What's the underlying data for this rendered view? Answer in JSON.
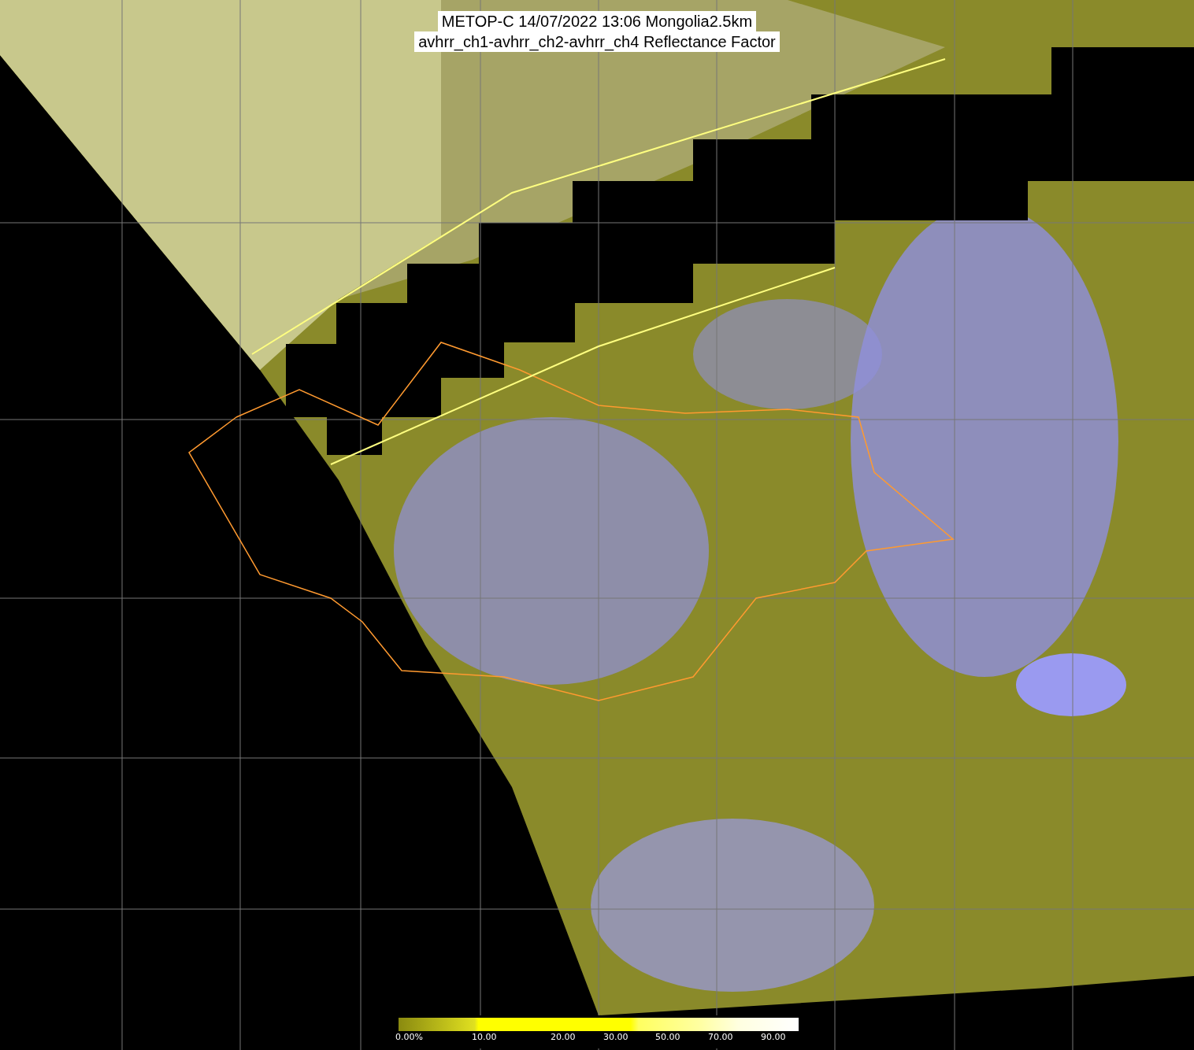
{
  "title_lines": [
    "METOP-C 14/07/2022 13:06 Mongolia2.5km",
    "avhrr_ch1-avhrr_ch2-avhrr_ch4 Reflectance Factor"
  ],
  "colorbar": {
    "tick_labels": [
      "0.00%",
      "10.00",
      "20.00",
      "30.00",
      "50.00",
      "70.00",
      "90.00"
    ]
  }
}
